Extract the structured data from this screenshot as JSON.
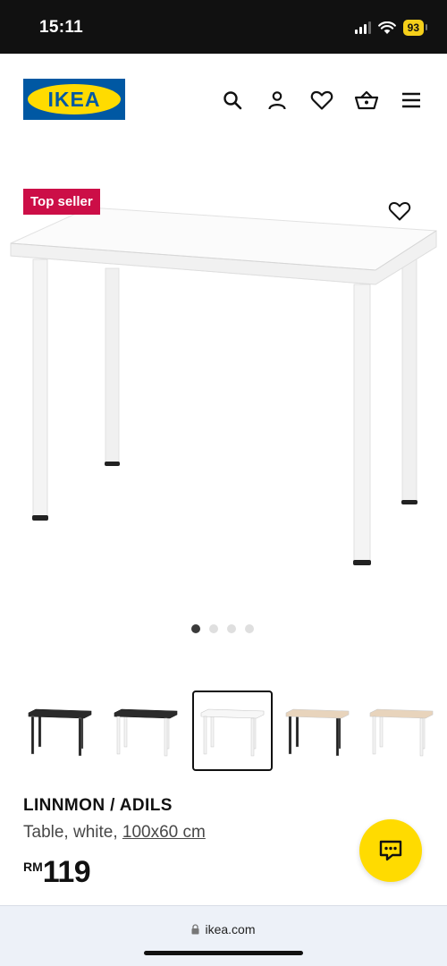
{
  "status_bar": {
    "time": "15:11",
    "battery": "93"
  },
  "brand": {
    "logo_text": "IKEA"
  },
  "header": {
    "icons": [
      "search-icon",
      "account-icon",
      "heart-icon",
      "basket-icon",
      "menu-icon"
    ]
  },
  "product": {
    "badge": "Top seller",
    "name": "LINNMON / ADILS",
    "description_prefix": "Table, white, ",
    "dimensions_link": "100x60 cm",
    "currency": "RM",
    "price": "119",
    "gallery_dots": 4,
    "gallery_active": 0
  },
  "thumbnails": [
    {
      "variant": "black-brown top, black legs",
      "top_color": "#2b2b2b",
      "leg_color": "#1e1e1e"
    },
    {
      "variant": "black-brown top, white legs",
      "top_color": "#2b2b2b",
      "leg_color": "#f4f4f4"
    },
    {
      "variant": "white top, white legs",
      "top_color": "#f7f7f7",
      "leg_color": "#f4f4f4"
    },
    {
      "variant": "white stained oak top, black legs",
      "top_color": "#e8d4bc",
      "leg_color": "#1e1e1e"
    },
    {
      "variant": "white stained oak top, white legs",
      "top_color": "#e8d4bc",
      "leg_color": "#f4f4f4"
    }
  ],
  "selected_thumbnail": 2,
  "browser": {
    "url": "ikea.com"
  },
  "colors": {
    "brand_blue": "#0058a3",
    "brand_yellow": "#ffdb00",
    "badge_red": "#cc0e47"
  }
}
